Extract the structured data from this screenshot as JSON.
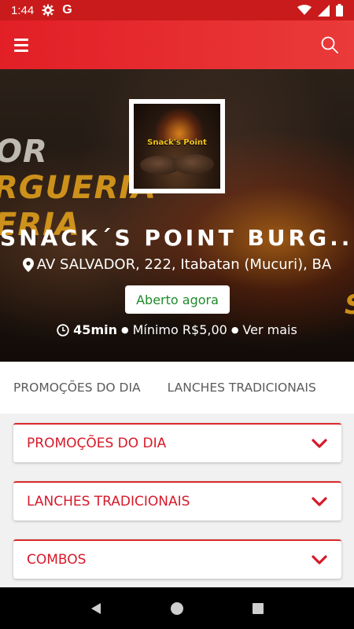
{
  "status_bar": {
    "time": "1:44",
    "g_letter": "G",
    "icons": [
      "gear-icon",
      "wifi-icon",
      "signal-icon",
      "battery-icon"
    ]
  },
  "app_bar": {
    "icons": [
      "menu-icon",
      "search-icon"
    ]
  },
  "hero": {
    "background_text": [
      "OR",
      "RGUERIA",
      "ERIA",
      "S"
    ],
    "logo_text": "Snack's Point",
    "name": "SNACK´S POINT BURG...",
    "address": "AV SALVADOR, 222, Itabatan (Mucuri), BA",
    "status_badge": "Aberto agora",
    "delivery_time": "45min",
    "minimum": "Mínimo R$5,00",
    "more": "Ver mais",
    "separator": "●"
  },
  "tabs": [
    {
      "label": "PROMOÇÕES DO DIA"
    },
    {
      "label": "LANCHES TRADICIONAIS"
    }
  ],
  "sections": [
    {
      "title": "PROMOÇÕES DO DIA"
    },
    {
      "title": "LANCHES TRADICIONAIS"
    },
    {
      "title": "COMBOS"
    }
  ],
  "colors": {
    "brand_red": "#e21f26",
    "section_title": "#d7192a",
    "open_green": "#1f8a2b"
  },
  "nav_bar": {
    "icons": [
      "back-icon",
      "home-icon",
      "recents-icon"
    ]
  }
}
